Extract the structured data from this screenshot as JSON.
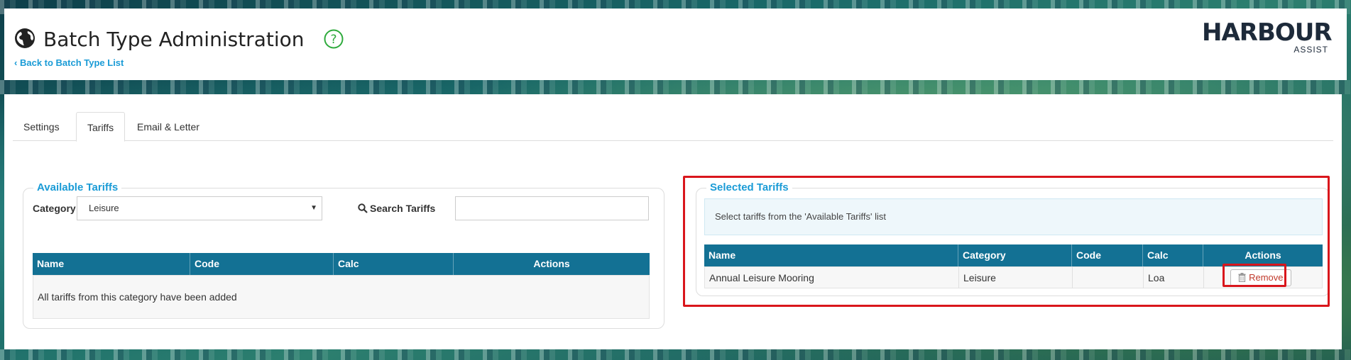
{
  "header": {
    "title": "Batch Type Administration",
    "back_link": "Back to Batch Type List",
    "logo_main": "HARBOUR",
    "logo_sub": "ASSIST"
  },
  "tabs": [
    {
      "label": "Settings",
      "active": false
    },
    {
      "label": "Tariffs",
      "active": true
    },
    {
      "label": "Email & Letter",
      "active": false
    }
  ],
  "available": {
    "legend": "Available Tariffs",
    "category_label": "Category",
    "category_value": "Leisure",
    "search_label": "Search Tariffs",
    "search_value": "",
    "columns": [
      "Name",
      "Code",
      "Calc",
      "Actions"
    ],
    "empty_message": "All tariffs from this category have been added"
  },
  "selected": {
    "legend": "Selected Tariffs",
    "info": "Select tariffs from the 'Available Tariffs' list",
    "columns": [
      "Name",
      "Category",
      "Code",
      "Calc",
      "Actions"
    ],
    "rows": [
      {
        "name": "Annual Leisure Mooring",
        "category": "Leisure",
        "code": "",
        "calc": "Loa",
        "action": "Remove"
      }
    ]
  },
  "colors": {
    "accent": "#1a9bd6",
    "grid_header": "#137194",
    "highlight": "#d9161c",
    "help_icon": "#2eaa3c"
  }
}
